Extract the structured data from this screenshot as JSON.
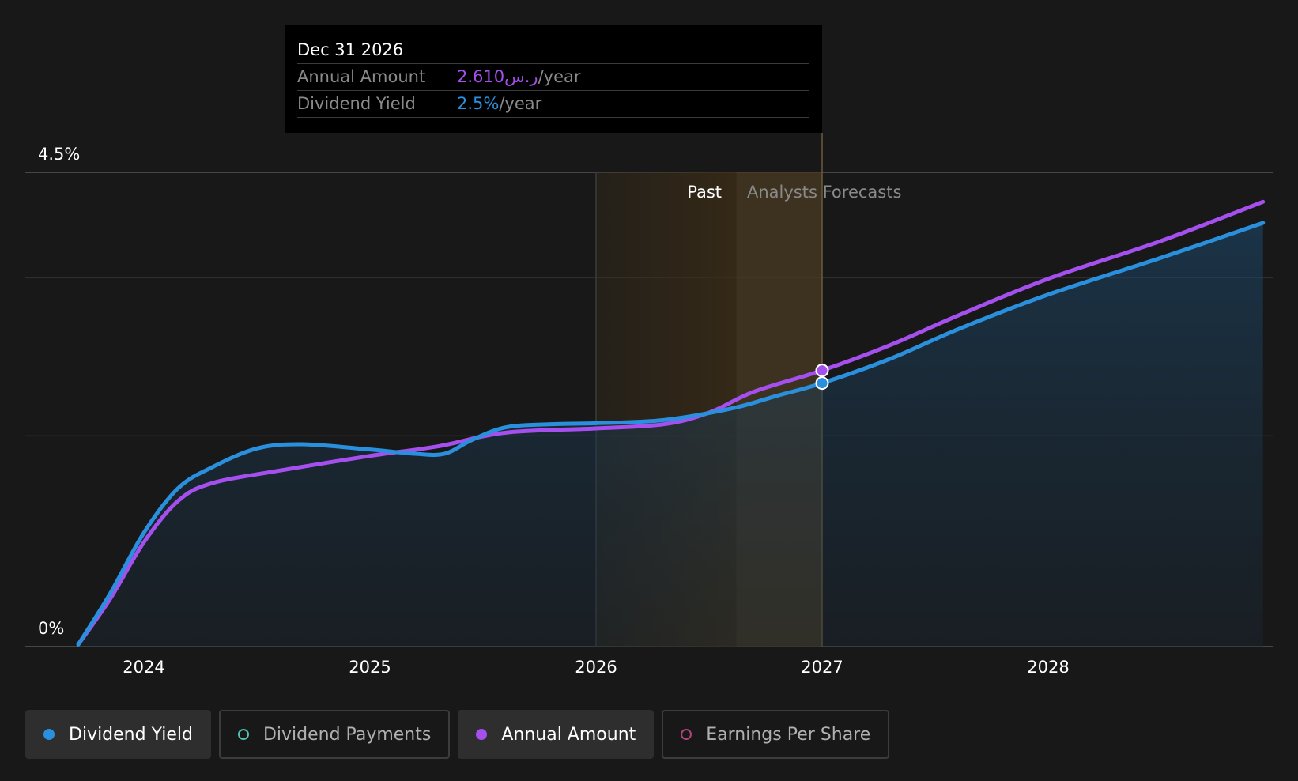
{
  "chart_data": {
    "type": "line",
    "y_tick_labels": [
      "4.5%",
      "0%"
    ],
    "ylim": [
      0,
      4.5
    ],
    "xlim": [
      2023.7,
      2028.95
    ],
    "x_ticks": [
      2024,
      2025,
      2026,
      2027,
      2028
    ],
    "x_tick_labels": [
      "2024",
      "2025",
      "2026",
      "2027",
      "2028"
    ],
    "region_labels": {
      "past": "Past",
      "forecast": "Analysts Forecasts"
    },
    "past_end": 2027.0,
    "series": [
      {
        "name": "Dividend Yield",
        "color": "#2a90dd",
        "points": [
          [
            2023.71,
            0.02
          ],
          [
            2023.85,
            0.5
          ],
          [
            2024.0,
            1.08
          ],
          [
            2024.15,
            1.5
          ],
          [
            2024.3,
            1.7
          ],
          [
            2024.5,
            1.88
          ],
          [
            2024.7,
            1.92
          ],
          [
            2025.0,
            1.87
          ],
          [
            2025.2,
            1.83
          ],
          [
            2025.33,
            1.83
          ],
          [
            2025.45,
            1.96
          ],
          [
            2025.6,
            2.08
          ],
          [
            2025.8,
            2.11
          ],
          [
            2026.0,
            2.12
          ],
          [
            2026.3,
            2.15
          ],
          [
            2026.6,
            2.26
          ],
          [
            2026.8,
            2.38
          ],
          [
            2027.0,
            2.5
          ],
          [
            2027.3,
            2.73
          ],
          [
            2027.6,
            3.01
          ],
          [
            2028.0,
            3.34
          ],
          [
            2028.5,
            3.69
          ],
          [
            2028.95,
            4.02
          ]
        ]
      },
      {
        "name": "Annual Amount",
        "color": "#a550ee",
        "points": [
          [
            2023.71,
            0.02
          ],
          [
            2023.85,
            0.45
          ],
          [
            2024.0,
            0.99
          ],
          [
            2024.15,
            1.38
          ],
          [
            2024.3,
            1.55
          ],
          [
            2024.6,
            1.67
          ],
          [
            2025.0,
            1.81
          ],
          [
            2025.3,
            1.9
          ],
          [
            2025.6,
            2.03
          ],
          [
            2026.0,
            2.07
          ],
          [
            2026.3,
            2.11
          ],
          [
            2026.5,
            2.22
          ],
          [
            2026.7,
            2.42
          ],
          [
            2027.0,
            2.62
          ],
          [
            2027.3,
            2.86
          ],
          [
            2027.6,
            3.14
          ],
          [
            2028.0,
            3.49
          ],
          [
            2028.5,
            3.85
          ],
          [
            2028.95,
            4.22
          ]
        ]
      }
    ],
    "highlight_x": 2027.0
  },
  "tooltip": {
    "date": "Dec 31 2026",
    "rows": [
      {
        "label": "Annual Amount",
        "value": "2.610ر.س",
        "unit": "/year"
      },
      {
        "label": "Dividend Yield",
        "value": "2.5%",
        "unit": "/year"
      }
    ]
  },
  "legend": [
    {
      "label": "Dividend Yield",
      "color": "#2a90dd",
      "active": true
    },
    {
      "label": "Dividend Payments",
      "color": "#4fc3b0",
      "active": false
    },
    {
      "label": "Annual Amount",
      "color": "#a550ee",
      "active": true
    },
    {
      "label": "Earnings Per Share",
      "color": "#b0457a",
      "active": false
    }
  ]
}
